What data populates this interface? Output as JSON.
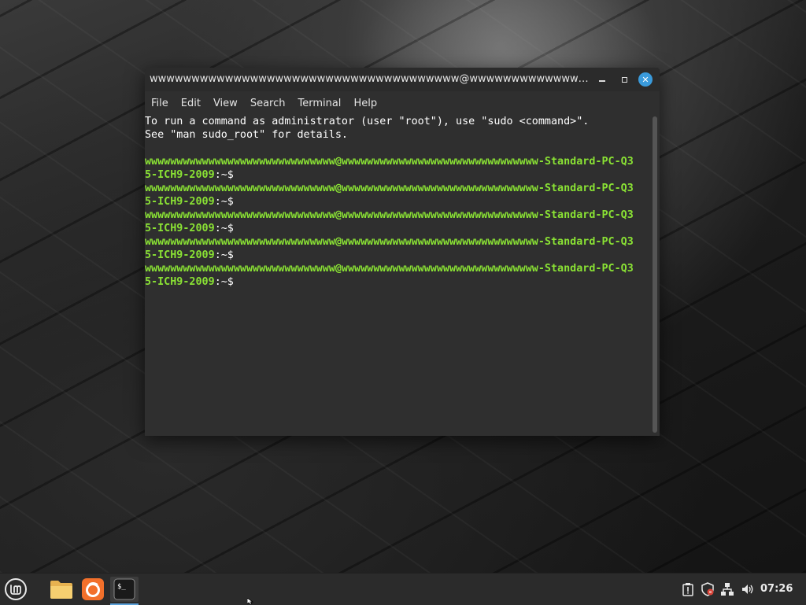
{
  "window": {
    "title": "wwwwwwwwwwwwwwwwwwwwwwwwwwwwwwwwwwwww@wwwwwwwwwwwwwwwwwwww...",
    "minimize_icon": "minimize-icon",
    "maximize_icon": "maximize-icon",
    "close_icon": "close-icon"
  },
  "menubar": {
    "items": [
      "File",
      "Edit",
      "View",
      "Search",
      "Terminal",
      "Help"
    ]
  },
  "terminal": {
    "intro": [
      "To run a command as administrator (user \"root\"), use \"sudo <command>\".",
      "See \"man sudo_root\" for details."
    ],
    "prompts": [
      {
        "line1": "wwwwwwwwwwwwwwwwwwwwwwwwwwwwww@wwwwwwwwwwwwwwwwwwwwwwwwwwwwwww-Standard-PC-Q3",
        "line2_user": "5-ICH9-2009",
        "line2_rest": ":~$"
      },
      {
        "line1": "wwwwwwwwwwwwwwwwwwwwwwwwwwwwww@wwwwwwwwwwwwwwwwwwwwwwwwwwwwwww-Standard-PC-Q3",
        "line2_user": "5-ICH9-2009",
        "line2_rest": ":~$"
      },
      {
        "line1": "wwwwwwwwwwwwwwwwwwwwwwwwwwwwww@wwwwwwwwwwwwwwwwwwwwwwwwwwwwwww-Standard-PC-Q3",
        "line2_user": "5-ICH9-2009",
        "line2_rest": ":~$"
      },
      {
        "line1": "wwwwwwwwwwwwwwwwwwwwwwwwwwwwww@wwwwwwwwwwwwwwwwwwwwwwwwwwwwwww-Standard-PC-Q3",
        "line2_user": "5-ICH9-2009",
        "line2_rest": ":~$"
      },
      {
        "line1": "wwwwwwwwwwwwwwwwwwwwwwwwwwwwww@wwwwwwwwwwwwwwwwwwwwwwwwwwwwwww-Standard-PC-Q3",
        "line2_user": "5-ICH9-2009",
        "line2_rest": ":~$"
      }
    ]
  },
  "taskbar": {
    "menu_icon": "linux-mint-menu-icon",
    "apps": [
      {
        "name": "files",
        "icon": "folder-icon"
      },
      {
        "name": "firefox",
        "icon": "firefox-icon"
      },
      {
        "name": "terminal",
        "icon": "terminal-icon",
        "icon_text": "$_",
        "active": true
      }
    ],
    "tray": [
      {
        "name": "notifications",
        "icon": "clipboard-alert-icon"
      },
      {
        "name": "update-manager",
        "icon": "shield-icon"
      },
      {
        "name": "network",
        "icon": "network-icon"
      },
      {
        "name": "volume",
        "icon": "volume-icon"
      }
    ],
    "clock": "07:26"
  },
  "colors": {
    "prompt_green": "#8ae234",
    "close_button": "#3a9bdc",
    "terminal_bg": "#2f2f2f",
    "taskbar_bg": "#2b2b2b"
  }
}
